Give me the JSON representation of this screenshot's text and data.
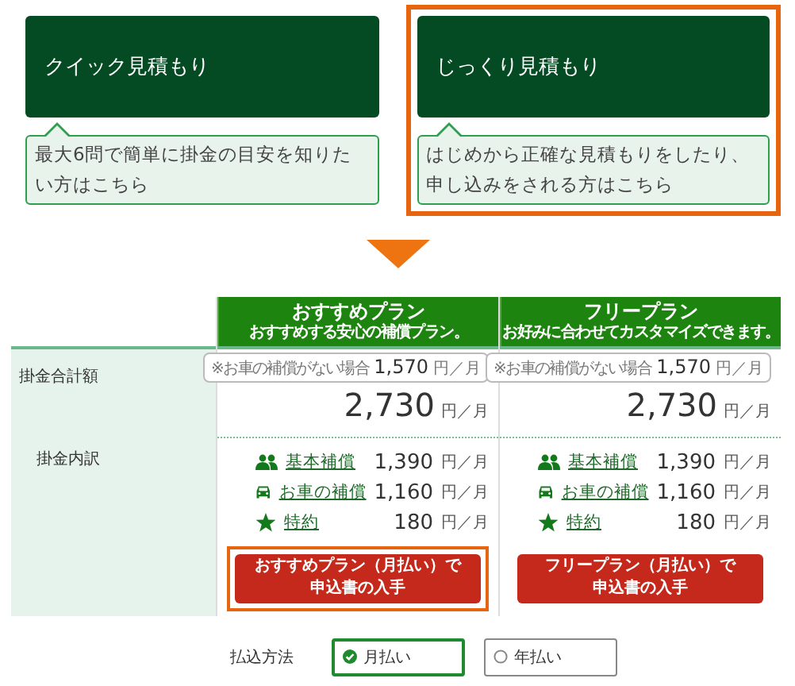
{
  "estimate_options": [
    {
      "title": "クイック見積もり",
      "description": "最大6問で簡単に掛金の目安を知りたい方はこちら",
      "highlighted": false
    },
    {
      "title": "じっくり見積もり",
      "description": "はじめから正確な見積もりをしたり、申し込みをされる方はこちら",
      "highlighted": true
    }
  ],
  "row_labels": [
    "掛金合計額",
    "掛金内訳"
  ],
  "plans": [
    {
      "name": "おすすめプラン",
      "tagline": "おすすめする安心の補償プラン。",
      "note_label": "※お車の補償がない場合",
      "note_amount": "1,570",
      "note_unit": "円／月",
      "total": "2,730",
      "total_unit": "円／月",
      "breakdown": [
        {
          "kind": "people",
          "label": "基本補償",
          "amount": "1,390",
          "unit": "円／月"
        },
        {
          "kind": "car",
          "label": "お車の補償",
          "amount": "1,160",
          "unit": "円／月"
        },
        {
          "kind": "star",
          "label": "特約",
          "amount": "180",
          "unit": "円／月"
        }
      ],
      "button_lines": [
        "おすすめプラン（月払い）で",
        "申込書の入手"
      ],
      "button_highlighted": true
    },
    {
      "name": "フリープラン",
      "tagline": "お好みに合わせてカスタマイズできます。",
      "note_label": "※お車の補償がない場合",
      "note_amount": "1,570",
      "note_unit": "円／月",
      "total": "2,730",
      "total_unit": "円／月",
      "breakdown": [
        {
          "kind": "people",
          "label": "基本補償",
          "amount": "1,390",
          "unit": "円／月"
        },
        {
          "kind": "car",
          "label": "お車の補償",
          "amount": "1,160",
          "unit": "円／月"
        },
        {
          "kind": "star",
          "label": "特約",
          "amount": "180",
          "unit": "円／月"
        }
      ],
      "button_lines": [
        "フリープラン（月払い）で",
        "申込書の入手"
      ],
      "button_highlighted": false
    }
  ],
  "payment": {
    "label": "払込方法",
    "options": [
      {
        "label": "月払い",
        "selected": true
      },
      {
        "label": "年払い",
        "selected": false
      }
    ]
  }
}
